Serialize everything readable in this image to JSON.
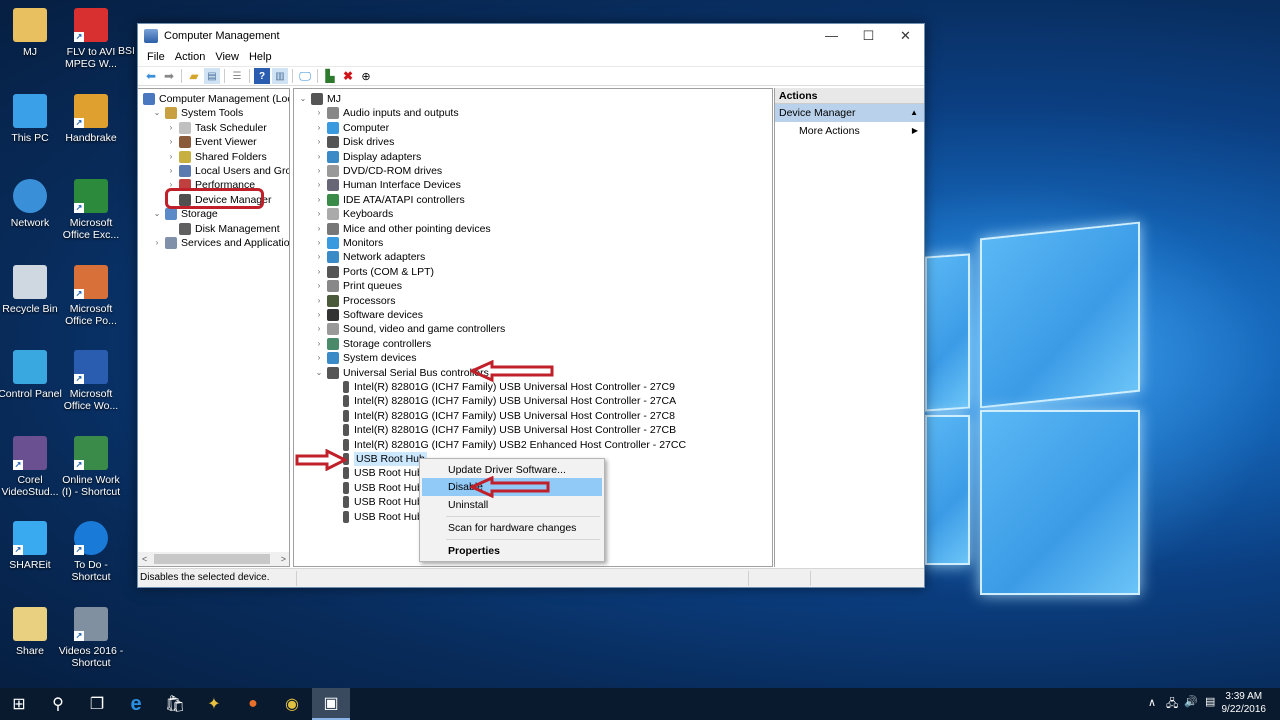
{
  "desktop": {
    "icons": [
      {
        "label": "MJ",
        "icon": "user-folder-icon",
        "shortcut": false
      },
      {
        "label": "FLV to AVI MPEG W...",
        "icon": "video-converter-icon",
        "shortcut": true
      },
      {
        "label": "This PC",
        "icon": "computer-icon",
        "shortcut": false
      },
      {
        "label": "Handbrake",
        "icon": "handbrake-icon",
        "shortcut": true
      },
      {
        "label": "Network",
        "icon": "network-icon",
        "shortcut": false
      },
      {
        "label": "Microsoft Office Exc...",
        "icon": "excel-icon",
        "shortcut": true
      },
      {
        "label": "Recycle Bin",
        "icon": "recycle-bin-icon",
        "shortcut": false
      },
      {
        "label": "Microsoft Office Po...",
        "icon": "powerpoint-icon",
        "shortcut": true
      },
      {
        "label": "Control Panel",
        "icon": "control-panel-icon",
        "shortcut": false
      },
      {
        "label": "Microsoft Office Wo...",
        "icon": "word-icon",
        "shortcut": true
      },
      {
        "label": "Corel VideoStud...",
        "icon": "corel-videostudio-icon",
        "shortcut": true
      },
      {
        "label": "Online Work (I) - Shortcut",
        "icon": "monitor-chart-icon",
        "shortcut": true
      },
      {
        "label": "SHAREit",
        "icon": "shareit-icon",
        "shortcut": true
      },
      {
        "label": "To Do - Shortcut",
        "icon": "info-icon",
        "shortcut": true
      },
      {
        "label": "Share",
        "icon": "folder-icon",
        "shortcut": false
      },
      {
        "label": "Videos 2016 - Shortcut",
        "icon": "camcorder-icon",
        "shortcut": true
      }
    ],
    "partial_label": "BSI"
  },
  "window": {
    "title": "Computer Management",
    "controls": {
      "minimize": "—",
      "maximize": "☐",
      "close": "✕"
    },
    "menu": [
      "File",
      "Action",
      "View",
      "Help"
    ],
    "toolbar": [
      "back-icon",
      "forward-icon",
      "up-folder-icon",
      "show-hide-tree-icon",
      "export-list-icon",
      "help-icon",
      "show-hide-action-icon",
      "monitor-icon",
      "update-driver-icon",
      "uninstall-icon",
      "disable-icon"
    ],
    "left_tree": [
      {
        "label": "Computer Management (Local",
        "level": 0,
        "expander": ""
      },
      {
        "label": "System Tools",
        "level": 1,
        "expander": "open"
      },
      {
        "label": "Task Scheduler",
        "level": 2,
        "expander": "closed"
      },
      {
        "label": "Event Viewer",
        "level": 2,
        "expander": "closed"
      },
      {
        "label": "Shared Folders",
        "level": 2,
        "expander": "closed"
      },
      {
        "label": "Local Users and Groups",
        "level": 2,
        "expander": "closed"
      },
      {
        "label": "Performance",
        "level": 2,
        "expander": "closed"
      },
      {
        "label": "Device Manager",
        "level": 2,
        "expander": "",
        "selected": true
      },
      {
        "label": "Storage",
        "level": 1,
        "expander": "open"
      },
      {
        "label": "Disk Management",
        "level": 2,
        "expander": ""
      },
      {
        "label": "Services and Applications",
        "level": 1,
        "expander": "closed"
      }
    ],
    "device_tree": {
      "root": "MJ",
      "categories": [
        "Audio inputs and outputs",
        "Computer",
        "Disk drives",
        "Display adapters",
        "DVD/CD-ROM drives",
        "Human Interface Devices",
        "IDE ATA/ATAPI controllers",
        "Keyboards",
        "Mice and other pointing devices",
        "Monitors",
        "Network adapters",
        "Ports (COM & LPT)",
        "Print queues",
        "Processors",
        "Software devices",
        "Sound, video and game controllers",
        "Storage controllers",
        "System devices",
        "Universal Serial Bus controllers"
      ],
      "usb_children": [
        "Intel(R) 82801G (ICH7 Family) USB Universal Host Controller - 27C9",
        "Intel(R) 82801G (ICH7 Family) USB Universal Host Controller - 27CA",
        "Intel(R) 82801G (ICH7 Family) USB Universal Host Controller - 27C8",
        "Intel(R) 82801G (ICH7 Family) USB Universal Host Controller - 27CB",
        "Intel(R) 82801G (ICH7 Family) USB2 Enhanced Host Controller - 27CC",
        "USB Root Hub",
        "USB Root Hub",
        "USB Root Hub",
        "USB Root Hub",
        "USB Root Hub"
      ]
    },
    "context_menu": {
      "items": [
        "Update Driver Software...",
        "Disable",
        "Uninstall",
        "Scan for hardware changes",
        "Properties"
      ],
      "highlighted": "Disable"
    },
    "actions": {
      "header": "Actions",
      "section": "Device Manager",
      "more": "More Actions"
    },
    "status": "Disables the selected device."
  },
  "taskbar": {
    "items": [
      "start-icon",
      "search-icon",
      "task-view-icon",
      "edge-icon",
      "store-icon",
      "app-icon",
      "firefox-icon",
      "chrome-icon",
      "computer-management-icon"
    ],
    "time": "3:39 AM",
    "date": "9/22/2016"
  },
  "colors": {
    "annotation_red": "#c0202a",
    "selection_blue": "#cce8ff",
    "menu_highlight": "#91c9f7"
  }
}
